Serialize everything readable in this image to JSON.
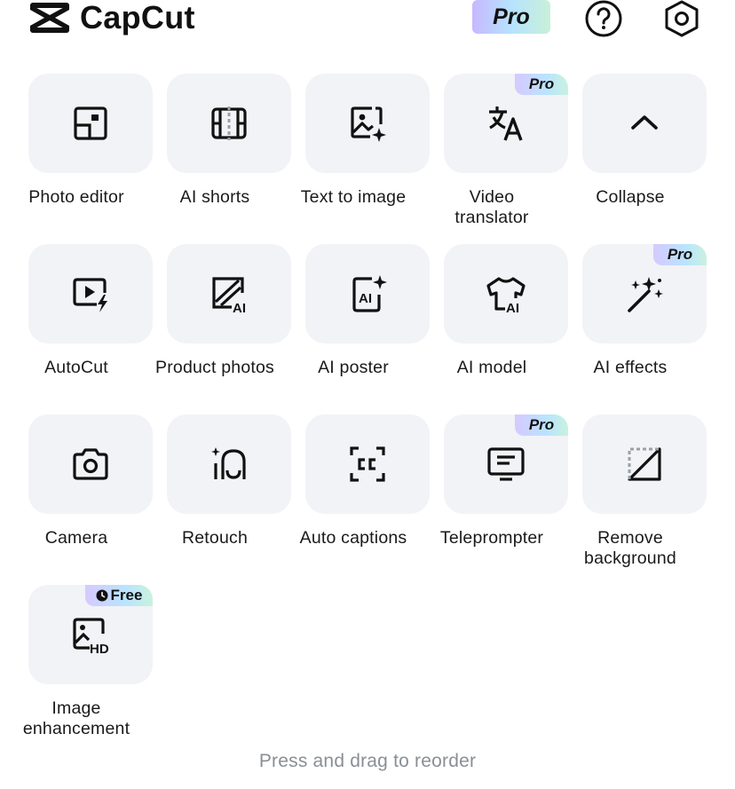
{
  "header": {
    "app_name": "CapCut",
    "pro_label": "Pro",
    "help_icon": "help-circle-icon",
    "settings_icon": "settings-hexagon-icon"
  },
  "tools": [
    {
      "label": "Photo editor",
      "icon": "photo-editor-icon",
      "badge": ""
    },
    {
      "label": "AI shorts",
      "icon": "ai-shorts-icon",
      "badge": ""
    },
    {
      "label": "Text to image",
      "icon": "text-to-image-icon",
      "badge": ""
    },
    {
      "label": "Video\ntranslator",
      "icon": "translate-icon",
      "badge": "Pro"
    },
    {
      "label": "Collapse",
      "icon": "chevron-up-icon",
      "badge": ""
    },
    {
      "label": "AutoCut",
      "icon": "autocut-icon",
      "badge": ""
    },
    {
      "label": "Product photos",
      "icon": "product-photos-icon",
      "badge": ""
    },
    {
      "label": "AI poster",
      "icon": "ai-poster-icon",
      "badge": ""
    },
    {
      "label": "AI model",
      "icon": "ai-model-icon",
      "badge": ""
    },
    {
      "label": "AI effects",
      "icon": "magic-wand-icon",
      "badge": "Pro"
    },
    {
      "label": "Camera",
      "icon": "camera-icon",
      "badge": ""
    },
    {
      "label": "Retouch",
      "icon": "retouch-icon",
      "badge": ""
    },
    {
      "label": "Auto captions",
      "icon": "captions-icon",
      "badge": ""
    },
    {
      "label": "Teleprompter",
      "icon": "teleprompter-icon",
      "badge": "Pro"
    },
    {
      "label": "Remove\nbackground",
      "icon": "remove-background-icon",
      "badge": ""
    },
    {
      "label": "Image\nenhancement",
      "icon": "image-hd-icon",
      "badge": "Free"
    }
  ],
  "footer": {
    "hint": "Press and drag to reorder"
  }
}
